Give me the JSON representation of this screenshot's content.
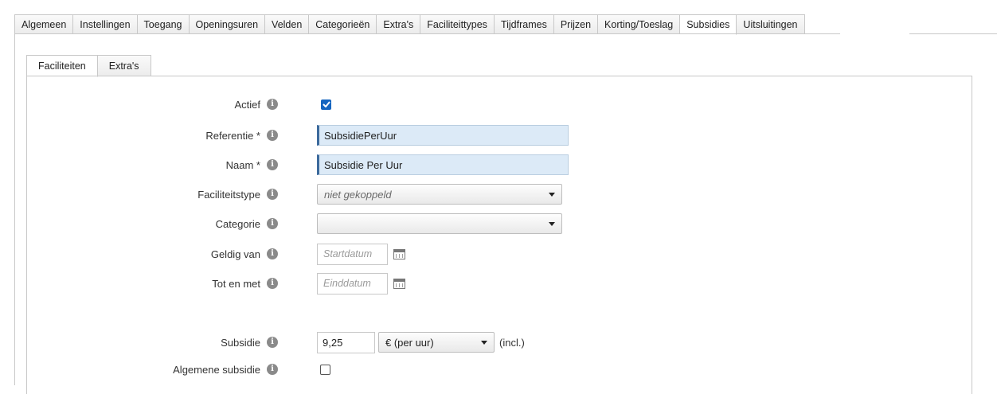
{
  "top_tabs": [
    "Algemeen",
    "Instellingen",
    "Toegang",
    "Openingsuren",
    "Velden",
    "Categorieën",
    "Extra's",
    "Faciliteittypes",
    "Tijdframes",
    "Prijzen",
    "Korting/Toeslag",
    "Subsidies",
    "Uitsluitingen"
  ],
  "top_tab_active": "Subsidies",
  "sub_tabs": [
    "Faciliteiten",
    "Extra's"
  ],
  "sub_tab_active": "Faciliteiten",
  "form": {
    "actief": {
      "label": "Actief",
      "checked": true
    },
    "referentie": {
      "label": "Referentie *",
      "value": "SubsidiePerUur"
    },
    "naam": {
      "label": "Naam *",
      "value": "Subsidie Per Uur"
    },
    "faciliteitstype": {
      "label": "Faciliteitstype",
      "value": "niet gekoppeld"
    },
    "categorie": {
      "label": "Categorie",
      "value": ""
    },
    "geldig_van": {
      "label": "Geldig van",
      "placeholder": "Startdatum"
    },
    "tot_en_met": {
      "label": "Tot en met",
      "placeholder": "Einddatum"
    },
    "subsidie": {
      "label": "Subsidie",
      "value": "9,25",
      "unit": "€ (per uur)",
      "suffix": "(incl.)"
    },
    "algemene_subsidie": {
      "label": "Algemene subsidie",
      "checked": false
    }
  },
  "colors": {
    "accent": "#1565c0",
    "input_bg": "#dceaf7"
  }
}
